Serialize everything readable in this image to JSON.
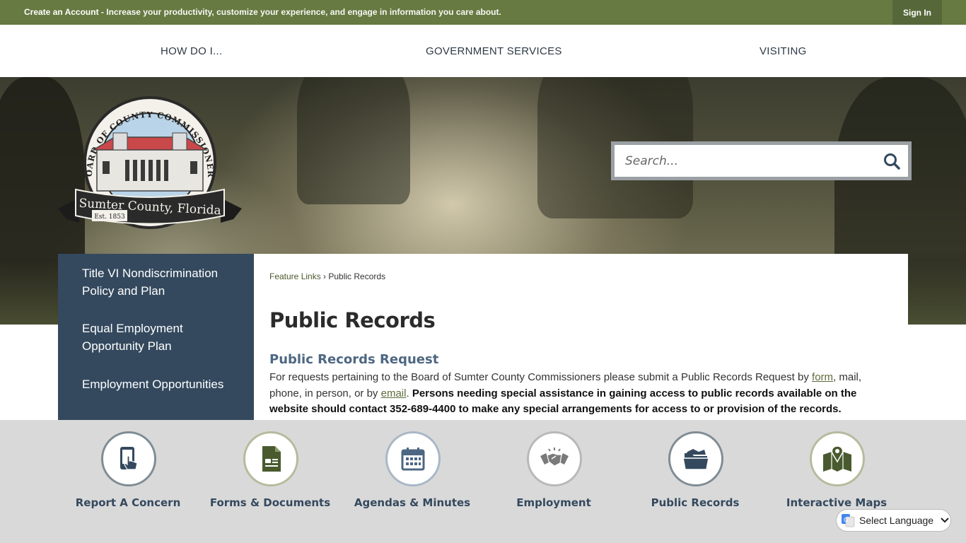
{
  "topbar": {
    "lead": "Create an Account",
    "rest": " - Increase your productivity, customize your experience, and engage in information you care about.",
    "sign_in": "Sign In"
  },
  "nav": {
    "items": [
      "HOW DO I...",
      "GOVERNMENT SERVICES",
      "VISITING"
    ]
  },
  "logo": {
    "arc_text": "BOARD OF COUNTY COMMISSIONERS",
    "banner_text": "Sumter County, Florida",
    "est": "Est. 1853"
  },
  "search": {
    "placeholder": "Search..."
  },
  "sidebar": {
    "items": [
      "Title VI Nondiscrimination Policy and Plan",
      "Equal Employment Opportunity Plan",
      "Employment Opportunities"
    ]
  },
  "breadcrumb": {
    "parent": "Feature Links",
    "sep": " › ",
    "current": "Public Records"
  },
  "content": {
    "title": "Public Records",
    "section_title": "Public Records Request",
    "p_part1": "For requests pertaining to the Board of Sumter County Commissioners please submit a Public Records Request by ",
    "link_form": "form",
    "p_part2": ", mail, phone, in person, or by ",
    "link_email": "email",
    "p_part3": ". ",
    "p_bold": "Persons needing special assistance in gaining access to public records available on the website should contact 352-689-4400 to make any special arrangements for access to or provision of the records."
  },
  "quicklinks": [
    {
      "label": "Report A Concern",
      "icon": "phone-touch-icon",
      "border": "#7f8c95"
    },
    {
      "label": "Forms & Documents",
      "icon": "document-icon",
      "border": "#b5bb9c"
    },
    {
      "label": "Agendas & Minutes",
      "icon": "calendar-icon",
      "border": "#a9b7c6"
    },
    {
      "label": "Employment",
      "icon": "handshake-icon",
      "border": "#b8b8b8"
    },
    {
      "label": "Public Records",
      "icon": "folder-icon",
      "border": "#7f8c95"
    },
    {
      "label": "Interactive Maps",
      "icon": "map-pin-icon",
      "border": "#b5bb9c"
    }
  ],
  "translate": {
    "label": "Select Language"
  },
  "colors": {
    "topbar": "#667a41",
    "sidebar": "#34495e",
    "heading_blue": "#4d6782",
    "icon_dark": "#34495e"
  }
}
